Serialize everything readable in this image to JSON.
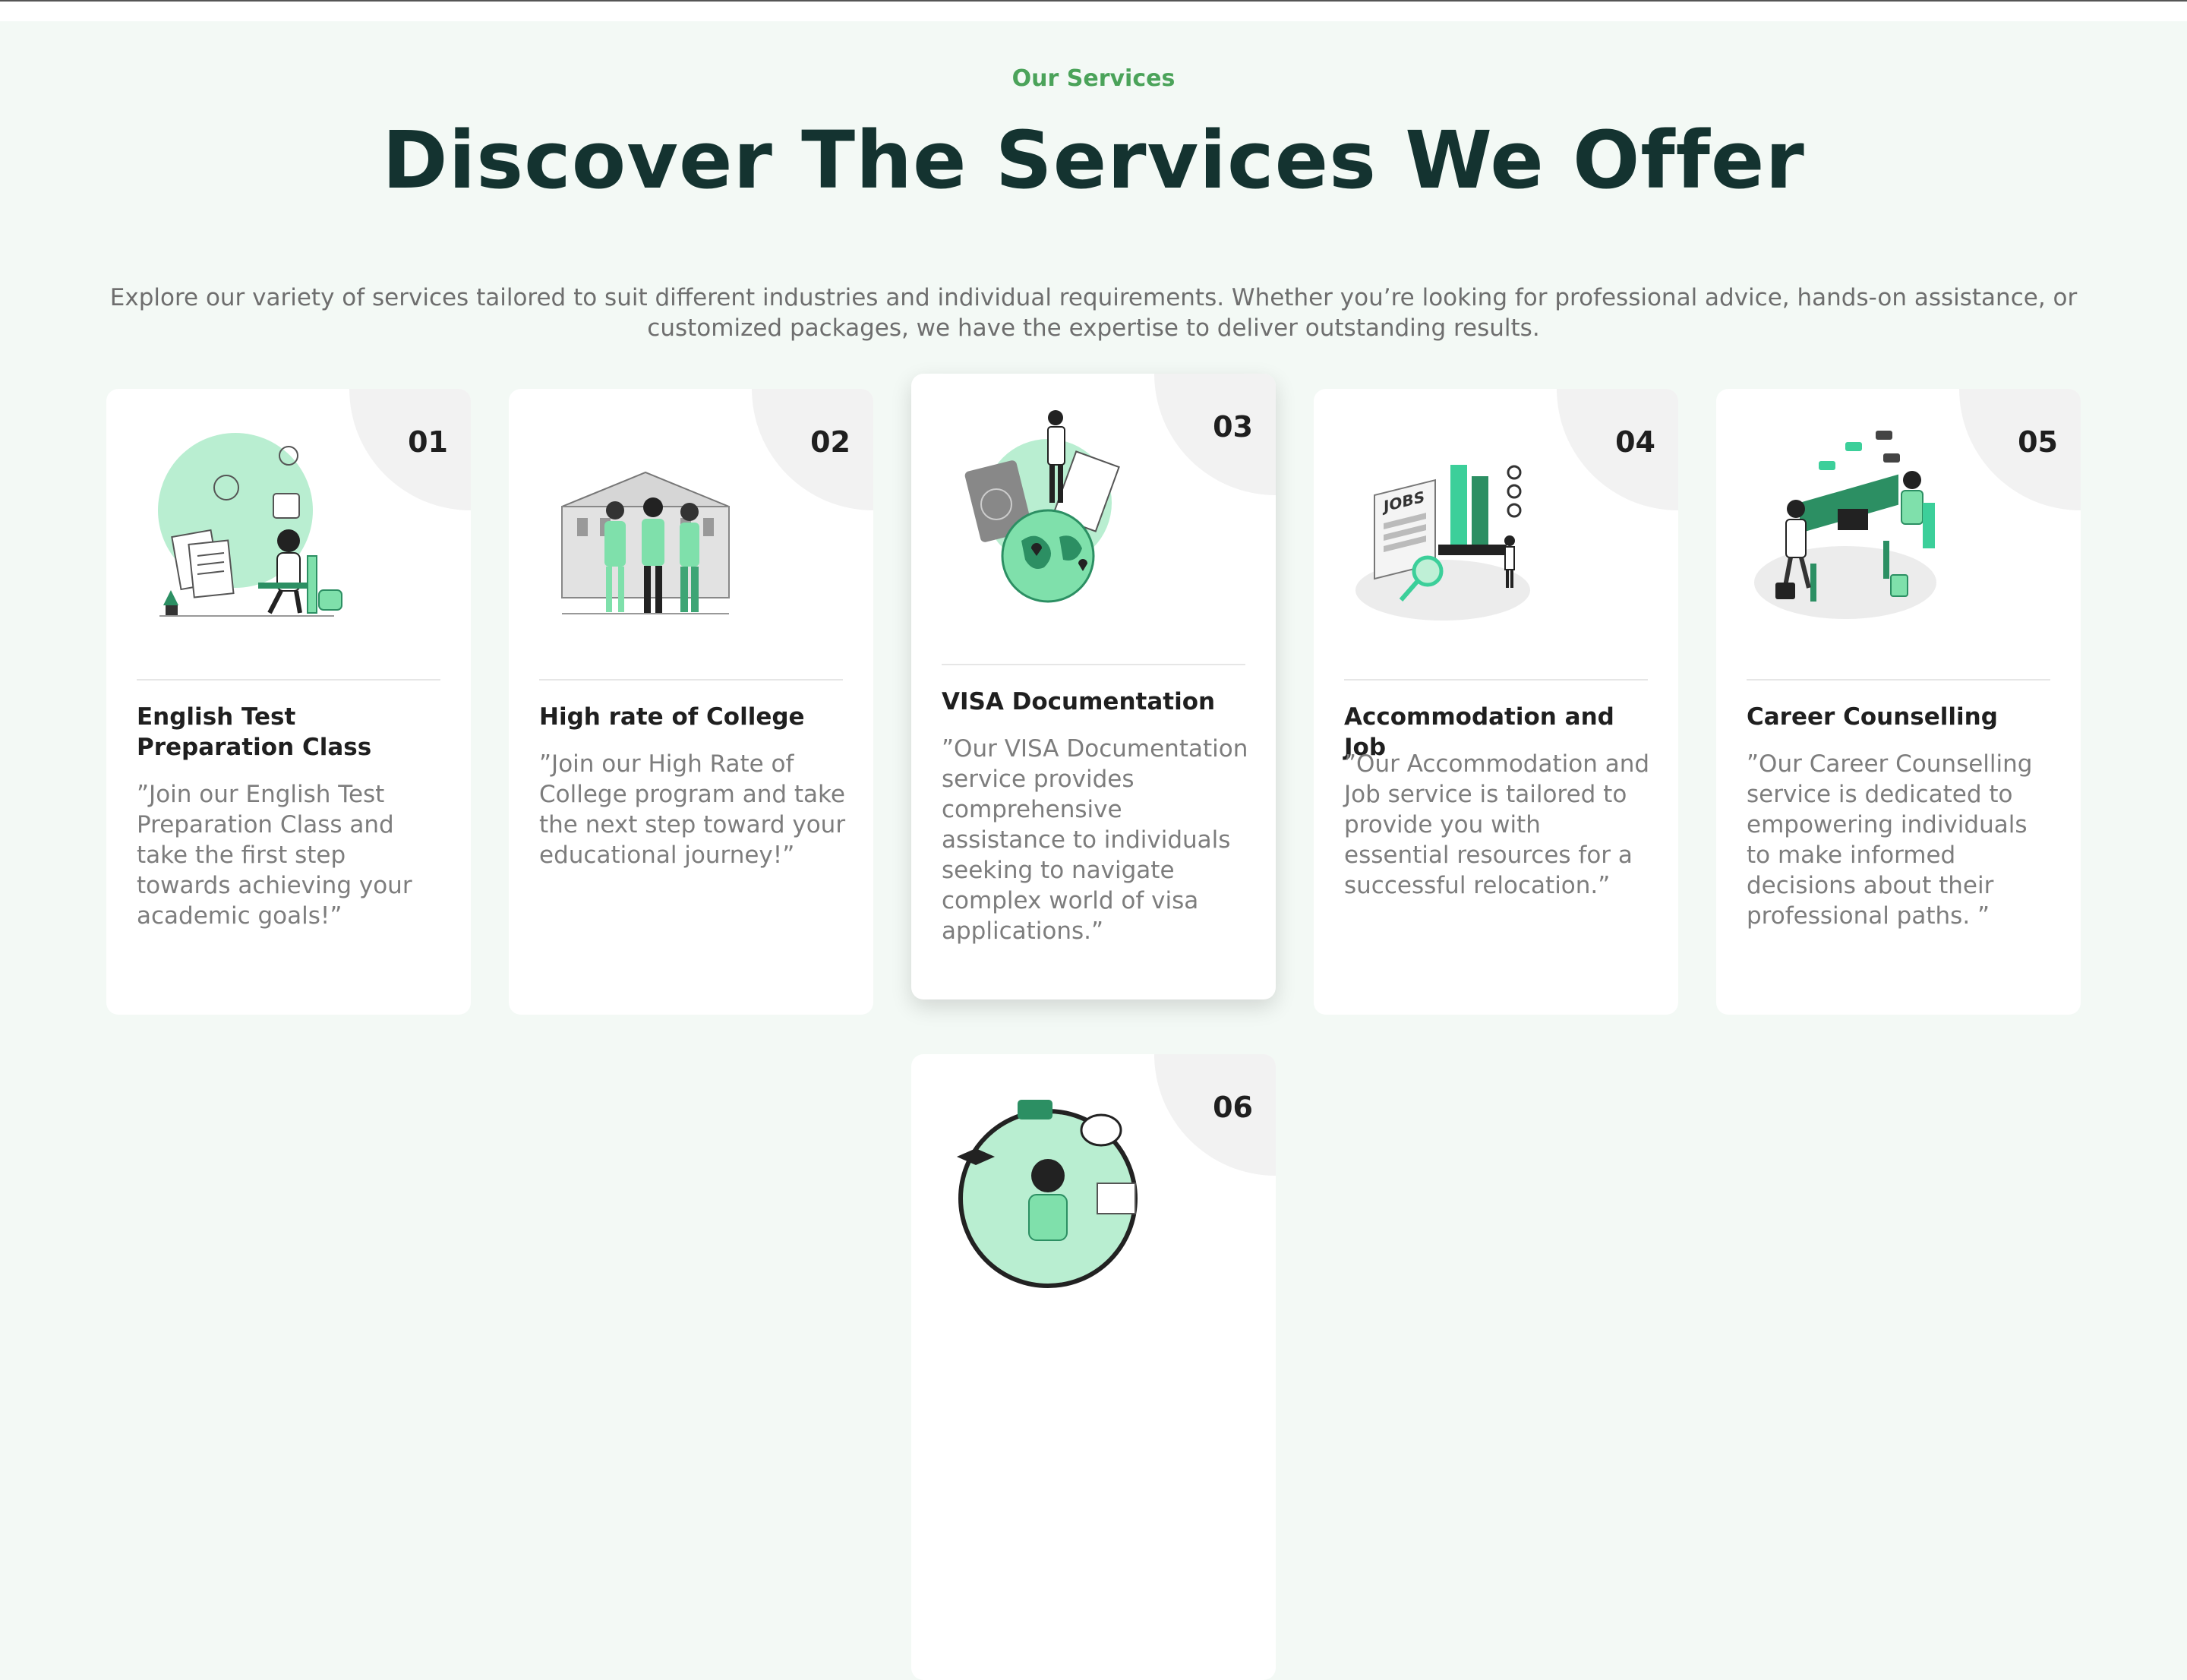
{
  "section": {
    "eyebrow": "Our Services",
    "title": "Discover The Services We Offer",
    "description": "Explore our variety of services tailored to suit different industries and individual requirements. Whether you’re looking for professional advice, hands-on assistance, or customized packages, we have the expertise to deliver outstanding results."
  },
  "cards": [
    {
      "number": "01",
      "title": "English Test Preparation Class",
      "text": "”Join our English Test Preparation Class and take the first step towards achieving your academic goals!”",
      "icon": "student-studying-illustration"
    },
    {
      "number": "02",
      "title": "High rate of College",
      "text": "”Join our High Rate of College program and take the next step toward your educational journey!”",
      "icon": "students-college-illustration"
    },
    {
      "number": "03",
      "title": "VISA Documentation",
      "text": "”Our VISA Documentation service provides comprehensive assistance to individuals seeking to navigate complex world of visa applications.”",
      "icon": "visa-globe-illustration"
    },
    {
      "number": "04",
      "title": "Accommodation and Job",
      "text": "”Our Accommodation and Job service is tailored to provide you with essential resources for a successful relocation.”",
      "icon": "jobs-newspaper-illustration"
    },
    {
      "number": "05",
      "title": "Career Counselling",
      "text": "”Our Career Counselling service is dedicated to empowering individuals to make informed decisions about their professional paths. ”",
      "icon": "career-meeting-illustration"
    },
    {
      "number": "06",
      "title": "",
      "text": "",
      "icon": "finance-person-illustration"
    }
  ],
  "colors": {
    "accent": "#4ba35a",
    "illustration": "#7fe0ab",
    "illustration_dark": "#2c8f63",
    "heading": "#143330",
    "background": "#f3f9f5"
  }
}
